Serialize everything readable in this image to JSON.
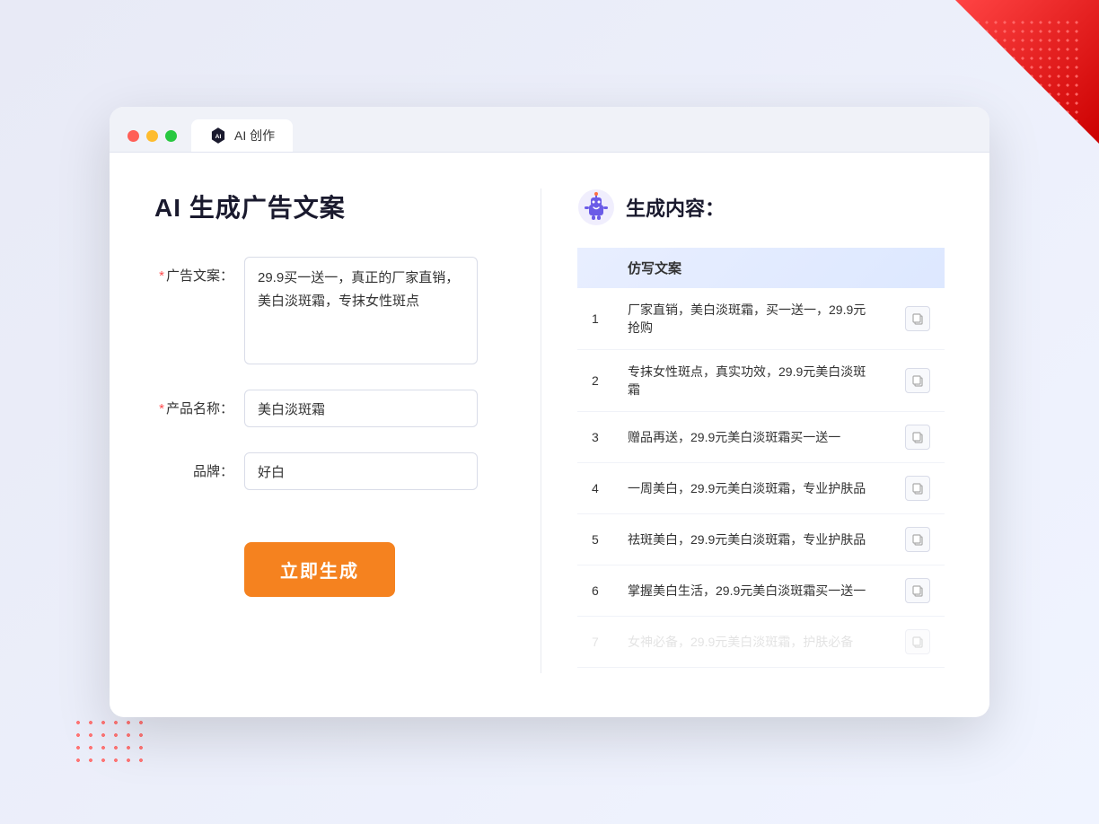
{
  "window": {
    "dot_red": "red",
    "dot_yellow": "yellow",
    "dot_green": "green",
    "tab_label": "AI 创作",
    "tab_icon_alt": "AI icon"
  },
  "page": {
    "title": "AI 生成广告文案"
  },
  "form": {
    "ad_text_label": "广告文案：",
    "ad_text_required": "*",
    "ad_text_value": "29.9买一送一，真正的厂家直销，美白淡斑霜，专抹女性斑点",
    "product_label": "产品名称：",
    "product_required": "*",
    "product_value": "美白淡斑霜",
    "brand_label": "品牌：",
    "brand_value": "好白",
    "generate_button": "立即生成"
  },
  "results": {
    "header_icon_alt": "robot",
    "header_title": "生成内容：",
    "column_label": "仿写文案",
    "items": [
      {
        "num": "1",
        "text": "厂家直销，美白淡斑霜，买一送一，29.9元抢购"
      },
      {
        "num": "2",
        "text": "专抹女性斑点，真实功效，29.9元美白淡斑霜"
      },
      {
        "num": "3",
        "text": "赠品再送，29.9元美白淡斑霜买一送一"
      },
      {
        "num": "4",
        "text": "一周美白，29.9元美白淡斑霜，专业护肤品"
      },
      {
        "num": "5",
        "text": "祛斑美白，29.9元美白淡斑霜，专业护肤品"
      },
      {
        "num": "6",
        "text": "掌握美白生活，29.9元美白淡斑霜买一送一"
      },
      {
        "num": "7",
        "text": "女神必备，29.9元美白淡斑霜，护肤必备",
        "faded": true
      }
    ]
  }
}
